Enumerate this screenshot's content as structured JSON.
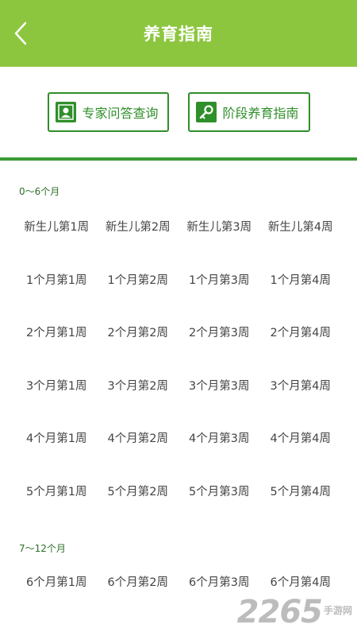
{
  "header": {
    "title": "养育指南",
    "back_icon": "chevron-left-icon",
    "bg_color": "#8cc63f"
  },
  "actions": {
    "expert_label": "专家问答查询",
    "expert_icon": "user-icon",
    "stage_label": "阶段养育指南",
    "stage_icon": "key-icon",
    "accent_color": "#2f8f2a"
  },
  "sections": [
    {
      "title": "0～6个月",
      "rows": [
        [
          "新生儿第1周",
          "新生儿第2周",
          "新生儿第3周",
          "新生儿第4周"
        ],
        [
          "1个月第1周",
          "1个月第2周",
          "1个月第3周",
          "1个月第4周"
        ],
        [
          "2个月第1周",
          "2个月第2周",
          "2个月第3周",
          "2个月第4周"
        ],
        [
          "3个月第1周",
          "3个月第2周",
          "3个月第3周",
          "3个月第4周"
        ],
        [
          "4个月第1周",
          "4个月第2周",
          "4个月第3周",
          "4个月第4周"
        ],
        [
          "5个月第1周",
          "5个月第2周",
          "5个月第3周",
          "5个月第4周"
        ]
      ]
    },
    {
      "title": "7～12个月",
      "rows": [
        [
          "6个月第1周",
          "6个月第2周",
          "6个月第3周",
          "6个月第4周"
        ]
      ]
    }
  ],
  "watermark": {
    "number": "2265",
    "text": "手游网"
  }
}
